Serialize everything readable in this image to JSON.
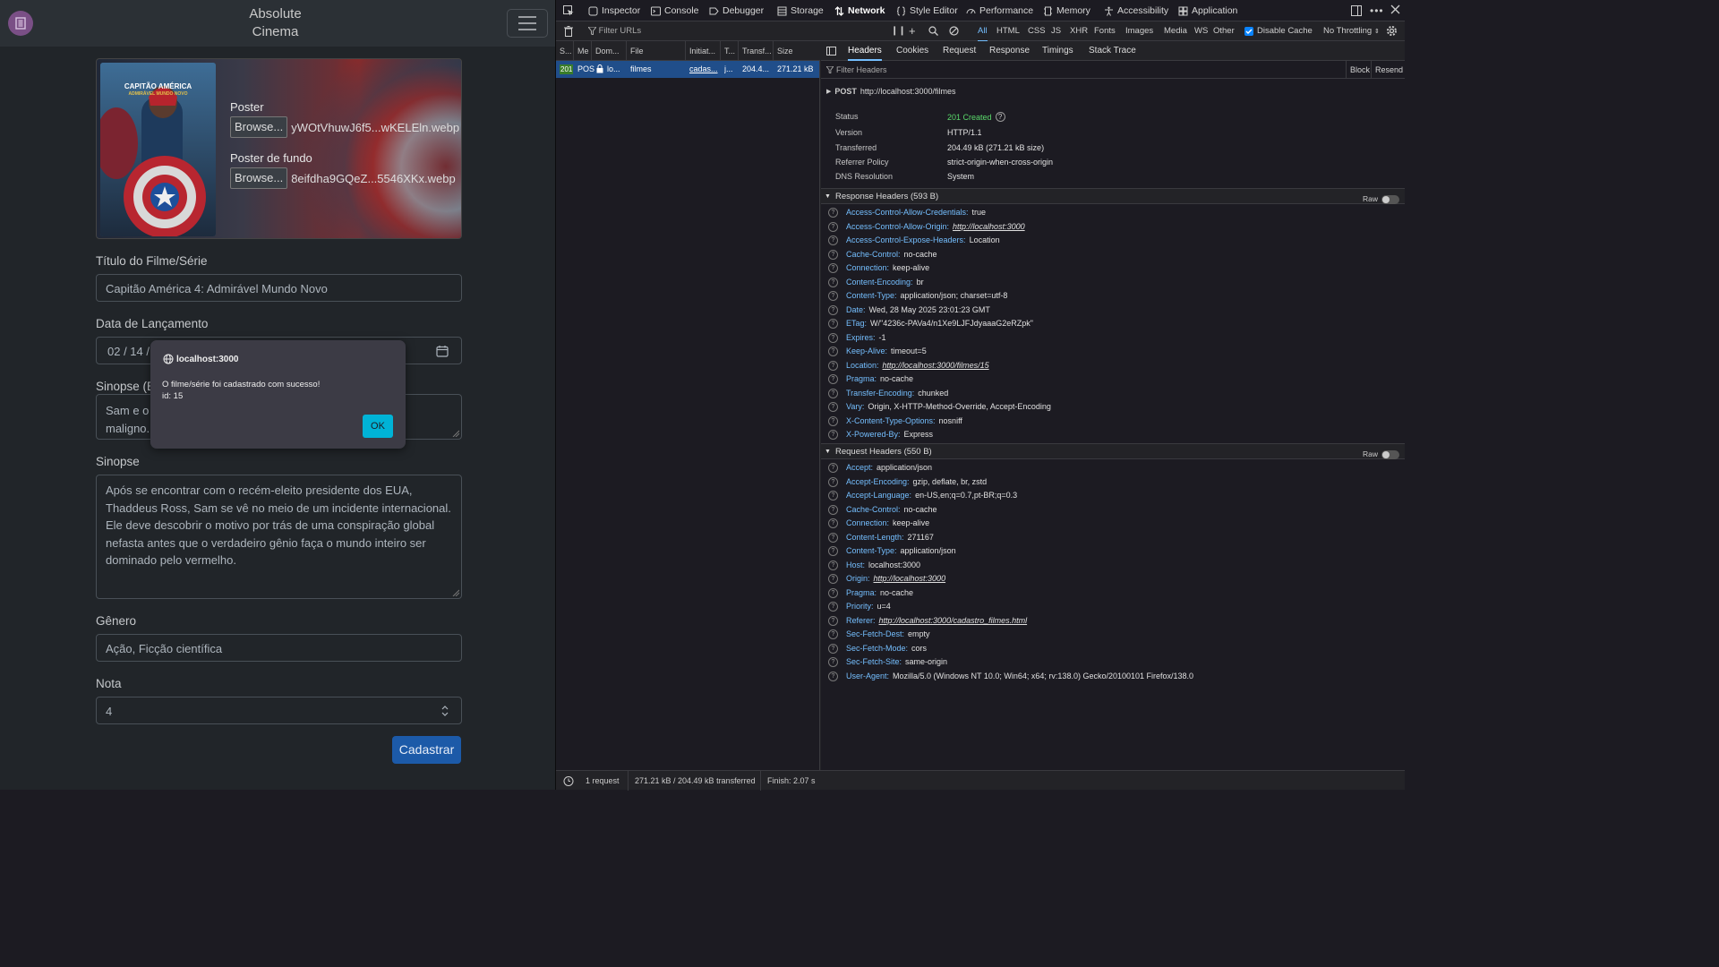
{
  "page": {
    "brand_line1": "Absolute",
    "brand_line2": "Cinema",
    "poster_label": "Poster",
    "poster_browse": "Browse...",
    "poster_file": "yWOtVhuwJ6f5...wKELEln.webp",
    "backdrop_label": "Poster de fundo",
    "backdrop_browse": "Browse...",
    "backdrop_file": "8eifdha9GQeZ...5546XKx.webp",
    "poster_title_line1": "CAPITÃO AMÉRICA",
    "poster_title_line2": "ADMIRÁVEL MUNDO NOVO",
    "title_label": "Título do Filme/Série",
    "title_value": "Capitão América 4: Admirável Mundo Novo",
    "date_label": "Data de Lançamento",
    "date_value": "02 / 14 /",
    "short_synopsis_label": "Sinopse (B",
    "short_synopsis_value": "Sam e o                                                                  io\nmaligno.",
    "synopsis_label": "Sinopse",
    "synopsis_value": "Após se encontrar com o recém-eleito presidente dos EUA,\nThaddeus Ross, Sam se vê no meio de um incidente internacional.\nEle deve descobrir o motivo por trás de uma conspiração global\nnefasta antes que o verdadeiro gênio faça o mundo inteiro ser\ndominado pelo vermelho.",
    "genre_label": "Gênero",
    "genre_value": "Ação, Ficção científica",
    "rating_label": "Nota",
    "rating_value": "4",
    "submit_label": "Cadastrar"
  },
  "dialog": {
    "origin": "localhost:3000",
    "message": "O filme/série foi cadastrado com sucesso!\nid: 15",
    "ok": "OK"
  },
  "devtools": {
    "tabs": [
      "Inspector",
      "Console",
      "Debugger",
      "Storage",
      "Network",
      "Style Editor",
      "Performance",
      "Memory",
      "Accessibility",
      "Application"
    ],
    "active_tab": "Network",
    "filter_urls_placeholder": "Filter URLs",
    "type_filters": [
      "All",
      "HTML",
      "CSS",
      "JS",
      "XHR",
      "Fonts",
      "Images",
      "Media",
      "WS",
      "Other"
    ],
    "disable_cache": "Disable Cache",
    "throttling": "No Throttling",
    "columns": [
      "S...",
      "Me",
      "Dom...",
      "File",
      "Initiat...",
      "T...",
      "Transf...",
      "Size"
    ],
    "request": {
      "status": "201",
      "method": "POS",
      "domain": "lo...",
      "file": "filmes",
      "initiator": "cadas...",
      "type": "j...",
      "transferred": "204.4...",
      "size": "271.21 kB"
    },
    "status_bar": {
      "requests": "1 request",
      "transferred": "271.21 kB / 204.49 kB transferred",
      "finish": "Finish: 2.07 s"
    },
    "detail_tabs": [
      "Headers",
      "Cookies",
      "Request",
      "Response",
      "Timings",
      "Stack Trace"
    ],
    "filter_headers_placeholder": "Filter Headers",
    "block_label": "Block",
    "resend_label": "Resend",
    "post_line_method": "POST",
    "post_line_url": "http://localhost:3000/filmes",
    "summary": [
      {
        "key": "Status",
        "value": "201 Created"
      },
      {
        "key": "Version",
        "value": "HTTP/1.1"
      },
      {
        "key": "Transferred",
        "value": "204.49 kB (271.21 kB size)"
      },
      {
        "key": "Referrer Policy",
        "value": "strict-origin-when-cross-origin"
      },
      {
        "key": "DNS Resolution",
        "value": "System"
      }
    ],
    "status_code_color": "#5ad96b",
    "response_headers_title": "Response Headers (593 B)",
    "request_headers_title": "Request Headers (550 B)",
    "raw_label": "Raw",
    "response_headers": [
      {
        "key": "Access-Control-Allow-Credentials:",
        "value": "true"
      },
      {
        "key": "Access-Control-Allow-Origin:",
        "value": "http://localhost:3000",
        "link": true
      },
      {
        "key": "Access-Control-Expose-Headers:",
        "value": "Location"
      },
      {
        "key": "Cache-Control:",
        "value": "no-cache"
      },
      {
        "key": "Connection:",
        "value": "keep-alive"
      },
      {
        "key": "Content-Encoding:",
        "value": "br"
      },
      {
        "key": "Content-Type:",
        "value": "application/json; charset=utf-8"
      },
      {
        "key": "Date:",
        "value": "Wed, 28 May 2025 23:01:23 GMT"
      },
      {
        "key": "ETag:",
        "value": "W/\"4236c-PAVa4/n1Xe9LJFJdyaaaG2eRZpk\""
      },
      {
        "key": "Expires:",
        "value": "-1"
      },
      {
        "key": "Keep-Alive:",
        "value": "timeout=5"
      },
      {
        "key": "Location:",
        "value": "http://localhost:3000/filmes/15",
        "link": true
      },
      {
        "key": "Pragma:",
        "value": "no-cache"
      },
      {
        "key": "Transfer-Encoding:",
        "value": "chunked"
      },
      {
        "key": "Vary:",
        "value": "Origin, X-HTTP-Method-Override, Accept-Encoding"
      },
      {
        "key": "X-Content-Type-Options:",
        "value": "nosniff"
      },
      {
        "key": "X-Powered-By:",
        "value": "Express"
      }
    ],
    "request_headers": [
      {
        "key": "Accept:",
        "value": "application/json"
      },
      {
        "key": "Accept-Encoding:",
        "value": "gzip, deflate, br, zstd"
      },
      {
        "key": "Accept-Language:",
        "value": "en-US,en;q=0.7,pt-BR;q=0.3"
      },
      {
        "key": "Cache-Control:",
        "value": "no-cache"
      },
      {
        "key": "Connection:",
        "value": "keep-alive"
      },
      {
        "key": "Content-Length:",
        "value": "271167"
      },
      {
        "key": "Content-Type:",
        "value": "application/json"
      },
      {
        "key": "Host:",
        "value": "localhost:3000"
      },
      {
        "key": "Origin:",
        "value": "http://localhost:3000",
        "link": true
      },
      {
        "key": "Pragma:",
        "value": "no-cache"
      },
      {
        "key": "Priority:",
        "value": "u=4"
      },
      {
        "key": "Referer:",
        "value": "http://localhost:3000/cadastro_filmes.html",
        "link": true
      },
      {
        "key": "Sec-Fetch-Dest:",
        "value": "empty"
      },
      {
        "key": "Sec-Fetch-Mode:",
        "value": "cors"
      },
      {
        "key": "Sec-Fetch-Site:",
        "value": "same-origin"
      },
      {
        "key": "User-Agent:",
        "value": "Mozilla/5.0 (Windows NT 10.0; Win64; x64; rv:138.0) Gecko/20100101 Firefox/138.0"
      }
    ]
  }
}
